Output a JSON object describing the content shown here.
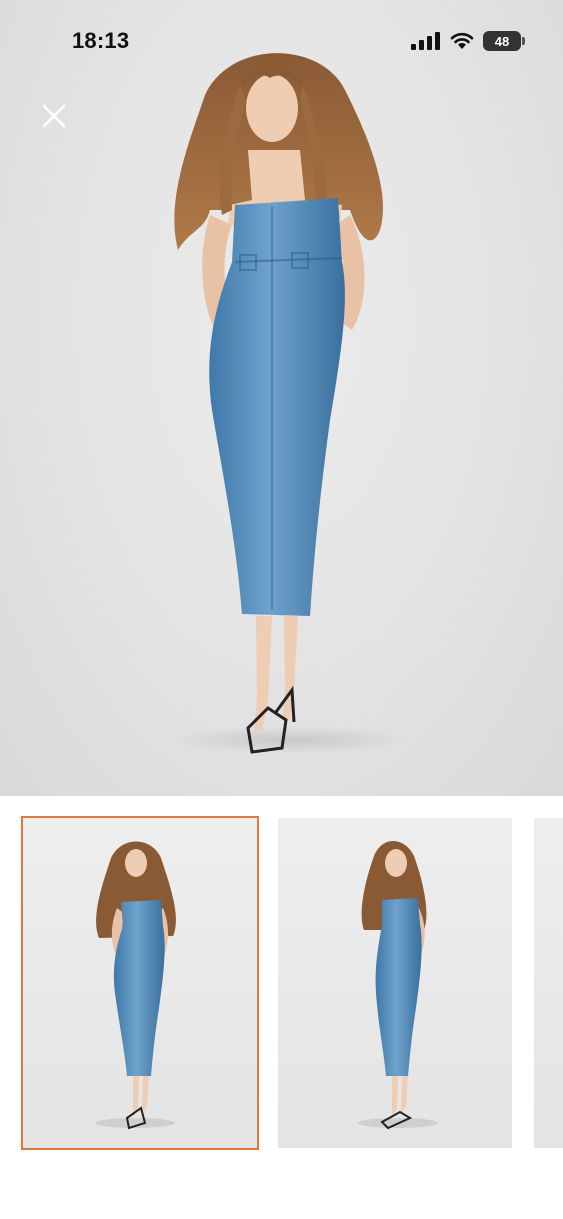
{
  "status_bar": {
    "time": "18:13",
    "battery_level": "48",
    "icons": [
      "cellular-signal-icon",
      "wifi-icon",
      "battery-icon"
    ]
  },
  "viewer": {
    "close_icon": "close-icon",
    "main_image_alt_icon": "model-photo",
    "selected_index": 0,
    "thumbnails": [
      {
        "index": 0,
        "selected": true
      },
      {
        "index": 1,
        "selected": false
      },
      {
        "index": 2,
        "selected": false
      }
    ]
  },
  "colors": {
    "accent_border": "#e07a3c",
    "denim": "#4a86b8",
    "background": "#e6e6e6"
  }
}
